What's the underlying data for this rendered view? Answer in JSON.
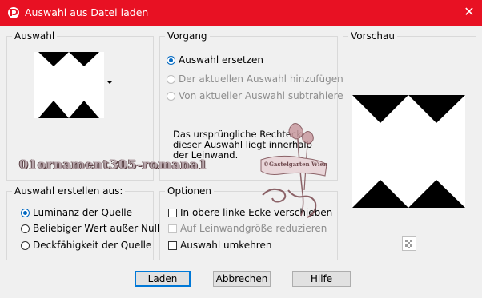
{
  "window": {
    "title": "Auswahl aus Datei laden",
    "close_glyph": "✕",
    "titlebar_color": "#e81123"
  },
  "auswahl_group": {
    "label": "Auswahl"
  },
  "vorgang_group": {
    "label": "Vorgang",
    "options": [
      {
        "label": "Auswahl ersetzen",
        "checked": true,
        "enabled": true
      },
      {
        "label": "Der aktuellen Auswahl hinzufügen",
        "checked": false,
        "enabled": false
      },
      {
        "label": "Von aktueller Auswahl subtrahieren",
        "checked": false,
        "enabled": false
      }
    ],
    "info_text": "Das ursprüngliche Rechteck dieser Auswahl liegt innerhalb der Leinwand."
  },
  "vorschau_group": {
    "label": "Vorschau",
    "transparency_icon": "checker-icon"
  },
  "erstellen_group": {
    "label": "Auswahl erstellen aus:",
    "options": [
      {
        "label": "Luminanz der Quelle",
        "checked": true
      },
      {
        "label": "Beliebiger Wert außer Null",
        "checked": false
      },
      {
        "label": "Deckfähigkeit der Quelle",
        "checked": false
      }
    ]
  },
  "optionen_group": {
    "label": "Optionen",
    "options": [
      {
        "label": "In obere linke Ecke verschieben",
        "checked": false,
        "enabled": true
      },
      {
        "label": "Auf Leinwandgröße reduzieren",
        "checked": false,
        "enabled": false
      },
      {
        "label": "Auswahl umkehren",
        "checked": false,
        "enabled": true
      }
    ]
  },
  "buttons": {
    "load": "Laden",
    "cancel": "Abbrechen",
    "help": "Hilfe"
  },
  "overlay": {
    "filename_text": "01ornament305-romana1",
    "watermark_lettering": "©Gastelgarten Wien"
  }
}
